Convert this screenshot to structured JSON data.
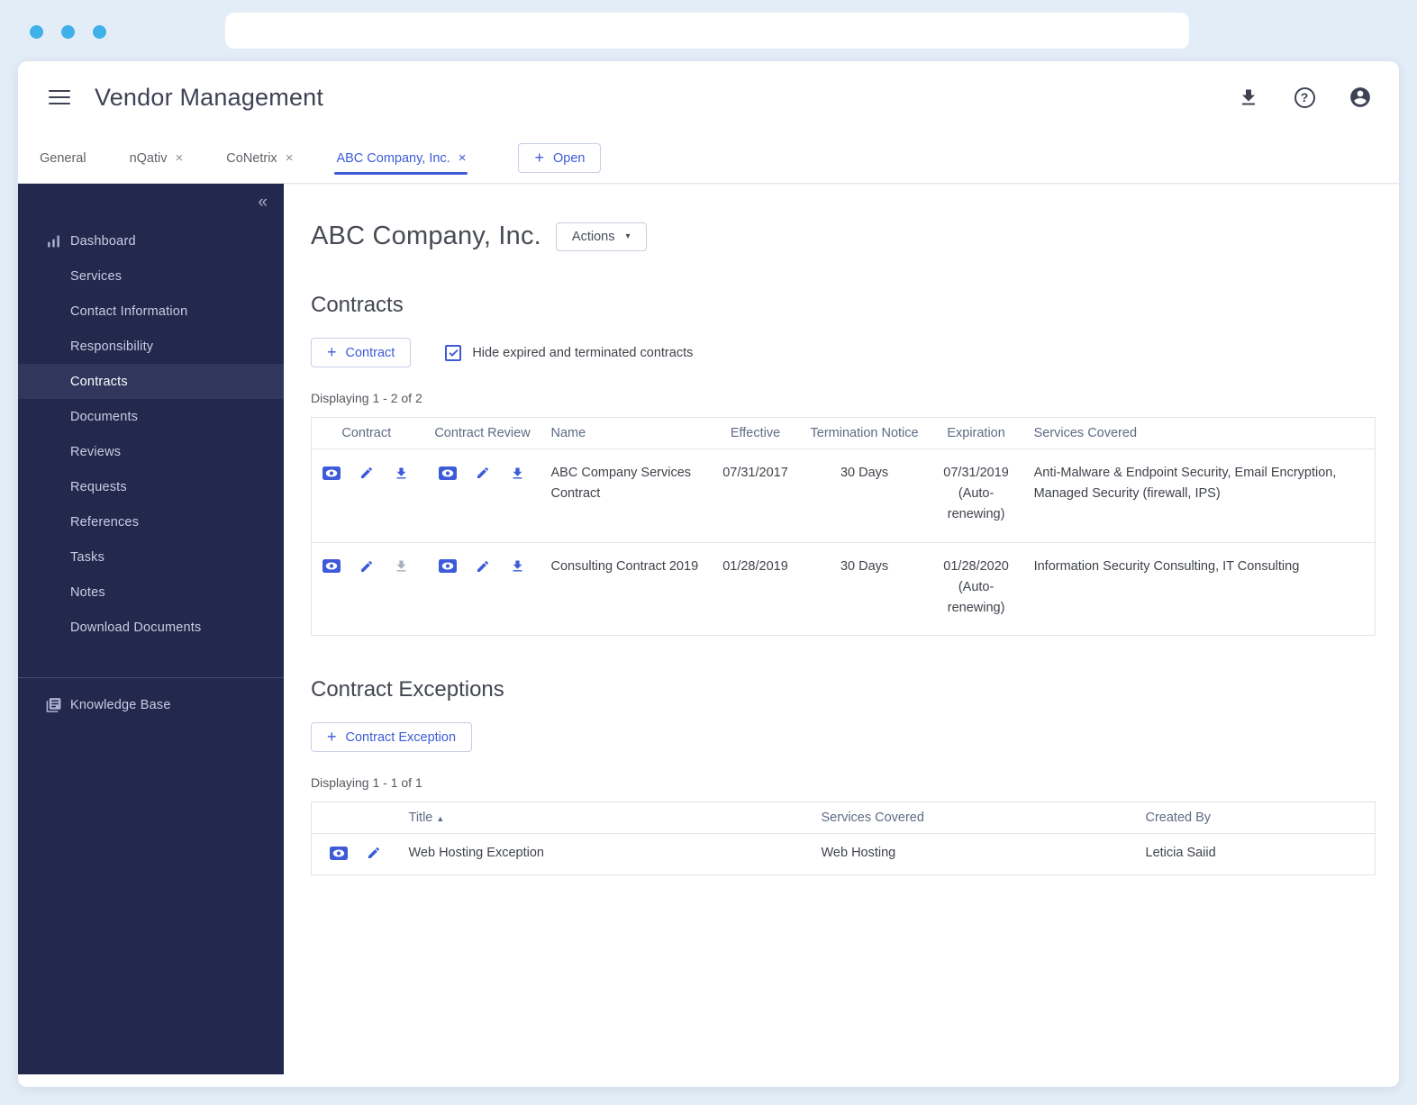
{
  "icons": {
    "collapse": "«",
    "close": "×",
    "plus": "+",
    "caret_down": "▾",
    "sort_asc": "▲",
    "help": "?"
  },
  "header": {
    "title": "Vendor Management"
  },
  "tabs": [
    {
      "label": "General"
    },
    {
      "label": "nQativ"
    },
    {
      "label": "CoNetrix"
    },
    {
      "label": "ABC Company, Inc."
    }
  ],
  "open_button_label": "Open",
  "sidebar": {
    "items": [
      "Dashboard",
      "Services",
      "Contact Information",
      "Responsibility",
      "Contracts",
      "Documents",
      "Reviews",
      "Requests",
      "References",
      "Tasks",
      "Notes",
      "Download Documents"
    ],
    "footer_item": "Knowledge Base",
    "active_item": "Contracts"
  },
  "main": {
    "page_title": "ABC Company, Inc.",
    "actions_button_label": "Actions",
    "contracts": {
      "heading": "Contracts",
      "add_button_label": "Contract",
      "filter_checkbox": {
        "label": "Hide expired and terminated contracts",
        "checked": true
      },
      "displaying": "Displaying 1 - 2 of 2",
      "table": {
        "headers": [
          "Contract",
          "Contract Review",
          "Name",
          "Effective",
          "Termination Notice",
          "Expiration",
          "Services Covered"
        ],
        "rows": [
          {
            "name": "ABC Company Services Contract",
            "effective": "07/31/2017",
            "termination_notice": "30 Days",
            "expiration": "07/31/2019 (Auto-renewing)",
            "services_covered": "Anti-Malware & Endpoint Security, Email Encryption, Managed Security (firewall, IPS)"
          },
          {
            "name": "Consulting Contract 2019",
            "effective": "01/28/2019",
            "termination_notice": "30 Days",
            "expiration": "01/28/2020 (Auto-renewing)",
            "services_covered": "Information Security Consulting, IT Consulting"
          }
        ]
      }
    },
    "contract_exceptions": {
      "heading": "Contract Exceptions",
      "add_button_label": "Contract Exception",
      "displaying": "Displaying 1 - 1 of 1",
      "table": {
        "headers": [
          "Title",
          "Services Covered",
          "Created By"
        ],
        "rows": [
          {
            "title": "Web Hosting Exception",
            "services_covered": "Web Hosting",
            "created_by": "Leticia Saiid"
          }
        ]
      }
    }
  },
  "colors": {
    "accent": "#3D5BD9",
    "sidebar_bg": "#23284D",
    "page_bg": "#E3EDF7",
    "browser_dot": "#3FB0E8"
  }
}
